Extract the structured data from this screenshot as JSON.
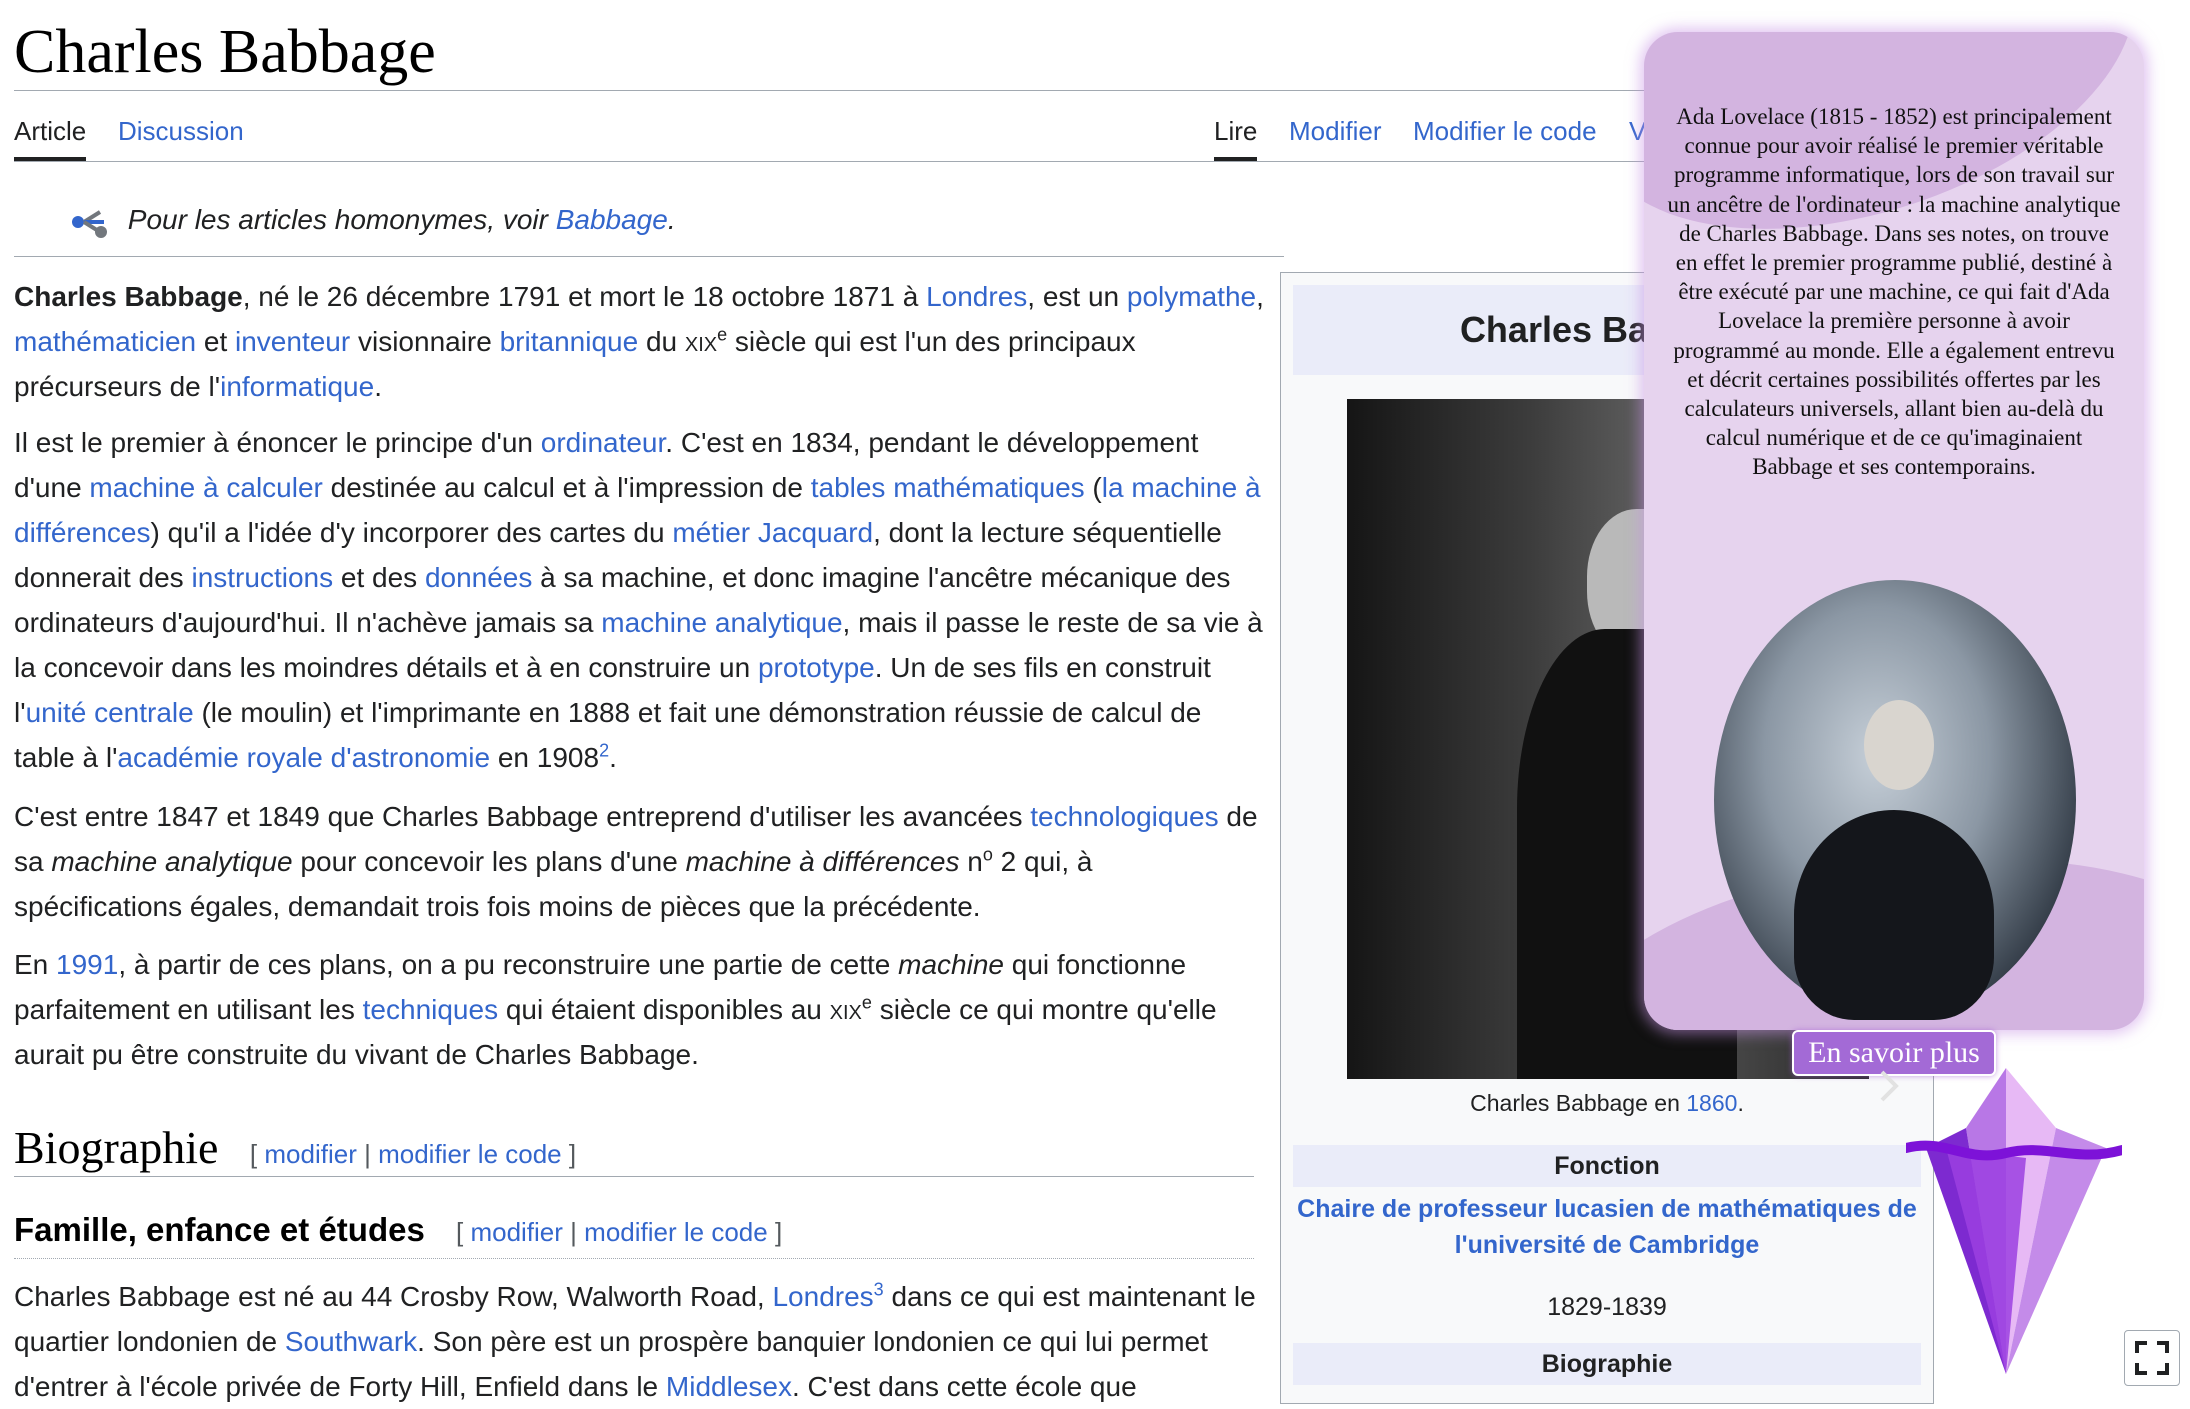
{
  "page": {
    "title": "Charles Babbage",
    "tabs_left": [
      "Article",
      "Discussion"
    ],
    "tabs_right": [
      "Lire",
      "Modifier",
      "Modifier le code",
      "V"
    ]
  },
  "hatnote": {
    "prefix": "Pour les articles homonymes, voir",
    "link": "Babbage",
    "suffix": "."
  },
  "intro": {
    "p1": {
      "bold": "Charles Babbage",
      "t1": ", né le 26 décembre 1791 et mort le 18 octobre 1871 à ",
      "l_londres": "Londres",
      "t2": ", est un ",
      "l_polymathe": "polymathe",
      "t3": ", ",
      "l_math": "mathématicien",
      "t4": " et ",
      "l_inventeur": "inventeur",
      "t5": " visionnaire ",
      "l_brit": "britannique",
      "t6": " du ",
      "century": "xix",
      "century_sup": "e",
      "t7": " siècle qui est l'un des principaux précurseurs de l'",
      "l_info": "informatique",
      "t8": "."
    },
    "p2": {
      "t1": "Il est le premier à énoncer le principe d'un ",
      "l_ordinateur": "ordinateur",
      "t2": ". C'est en 1834, pendant le développement d'une ",
      "l_machine_calc": "machine à calculer",
      "t3": " destinée au calcul et à l'impression de ",
      "l_tables": "tables mathématiques",
      "t4": " (",
      "l_machine_diff": "la machine à différences",
      "t5": ") qu'il a l'idée d'y incorporer des cartes du ",
      "l_metier": "métier Jacquard",
      "t6": ", dont la lecture séquentielle donnerait des ",
      "l_instructions": "instructions",
      "t7": " et des ",
      "l_donnees": "données",
      "t8": " à sa machine, et donc imagine l'ancêtre mécanique des ordinateurs d'aujourd'hui. Il n'achève jamais sa ",
      "l_analytique": "machine analytique",
      "t9": ", mais il passe le reste de sa vie à la concevoir dans les moindres détails et à en construire un ",
      "l_prototype": "prototype",
      "t10": ". Un de ses fils en construit l'",
      "l_unite": "unité centrale",
      "t11": " (le moulin) et l'imprimante en 1888 et fait une démonstration réussie de calcul de table à l'",
      "l_academie": "académie royale d'astronomie",
      "t12": " en 1908",
      "ref": "2",
      "t13": "."
    },
    "p3": {
      "t1": "C'est entre 1847 et 1849 que Charles Babbage entreprend d'utiliser les avancées ",
      "l_techno": "technologiques",
      "t2": " de sa ",
      "i1": "machine analytique",
      "t3": " pour concevoir les plans d'une ",
      "i2": "machine à différences",
      "t4": " n",
      "sup": "o",
      "t5": " 2 qui, à spécifications égales, demandait trois fois moins de pièces que la précédente."
    },
    "p4": {
      "t1": "En ",
      "l_1991": "1991",
      "t2": ", à partir de ces plans, on a pu reconstruire une partie de cette ",
      "i1": "machine",
      "t3": " qui fonctionne parfaitement en utilisant les ",
      "l_techniques": "techniques",
      "t4": " qui étaient disponibles au ",
      "century": "xix",
      "century_sup": "e",
      "t5": " siècle ce qui montre qu'elle aurait pu être construite du vivant de Charles Babbage."
    }
  },
  "section_bio": {
    "heading": "Biographie",
    "bracket_open": "[",
    "modifier": "modifier",
    "sep": "|",
    "modifier_code": "modifier le code",
    "bracket_close": "]"
  },
  "section_family": {
    "heading": "Famille, enfance et études",
    "bracket_open": "[",
    "modifier": "modifier",
    "sep": "|",
    "modifier_code": "modifier le code",
    "bracket_close": "]",
    "p": {
      "t1": "Charles Babbage est né au 44 Crosby Row, Walworth Road, ",
      "l_londres": "Londres",
      "ref": "3",
      "t2": " dans ce qui est maintenant le quartier londonien de ",
      "l_southwark": "Southwark",
      "t3": ". Son père est un prospère banquier londonien ce qui lui permet d'entrer à l'école privée de Forty Hill, Enfield dans le ",
      "l_middlesex": "Middlesex",
      "t4": ". C'est dans cette école que"
    }
  },
  "infobox": {
    "title": "Charles Babbage",
    "caption_prefix": "Charles Babbage en ",
    "caption_link": "1860",
    "caption_suffix": ".",
    "fonction_header": "Fonction",
    "chair": "Chaire de professeur lucasien de mathématiques de l'université de Cambridge",
    "years": "1829-1839",
    "bio_header": "Biographie"
  },
  "popup": {
    "text": "Ada Lovelace (1815 - 1852) est principalement connue pour avoir réalisé le premier véritable programme informatique, lors de son travail sur un ancêtre de l'ordinateur : la machine analytique de Charles Babbage. Dans ses notes, on trouve en effet le premier programme publié, destiné à être exécuté par une machine, ce qui fait d'Ada Lovelace la première personne à avoir programmé au monde. Elle a également entrevu et décrit certaines possibilités offertes par les calculateurs universels, allant bien au-delà du calcul numérique et de ce qu'imaginaient Babbage et ses contemporains.",
    "button": "En savoir plus"
  },
  "colors": {
    "link": "#3366cc",
    "popup_bg": "#e6d3ee",
    "popup_accent": "#a36ad6",
    "gem": "#9b3fe0"
  },
  "icons": [
    "disambiguation-icon",
    "gem-icon",
    "fullscreen-icon",
    "next-arrow-icon"
  ]
}
